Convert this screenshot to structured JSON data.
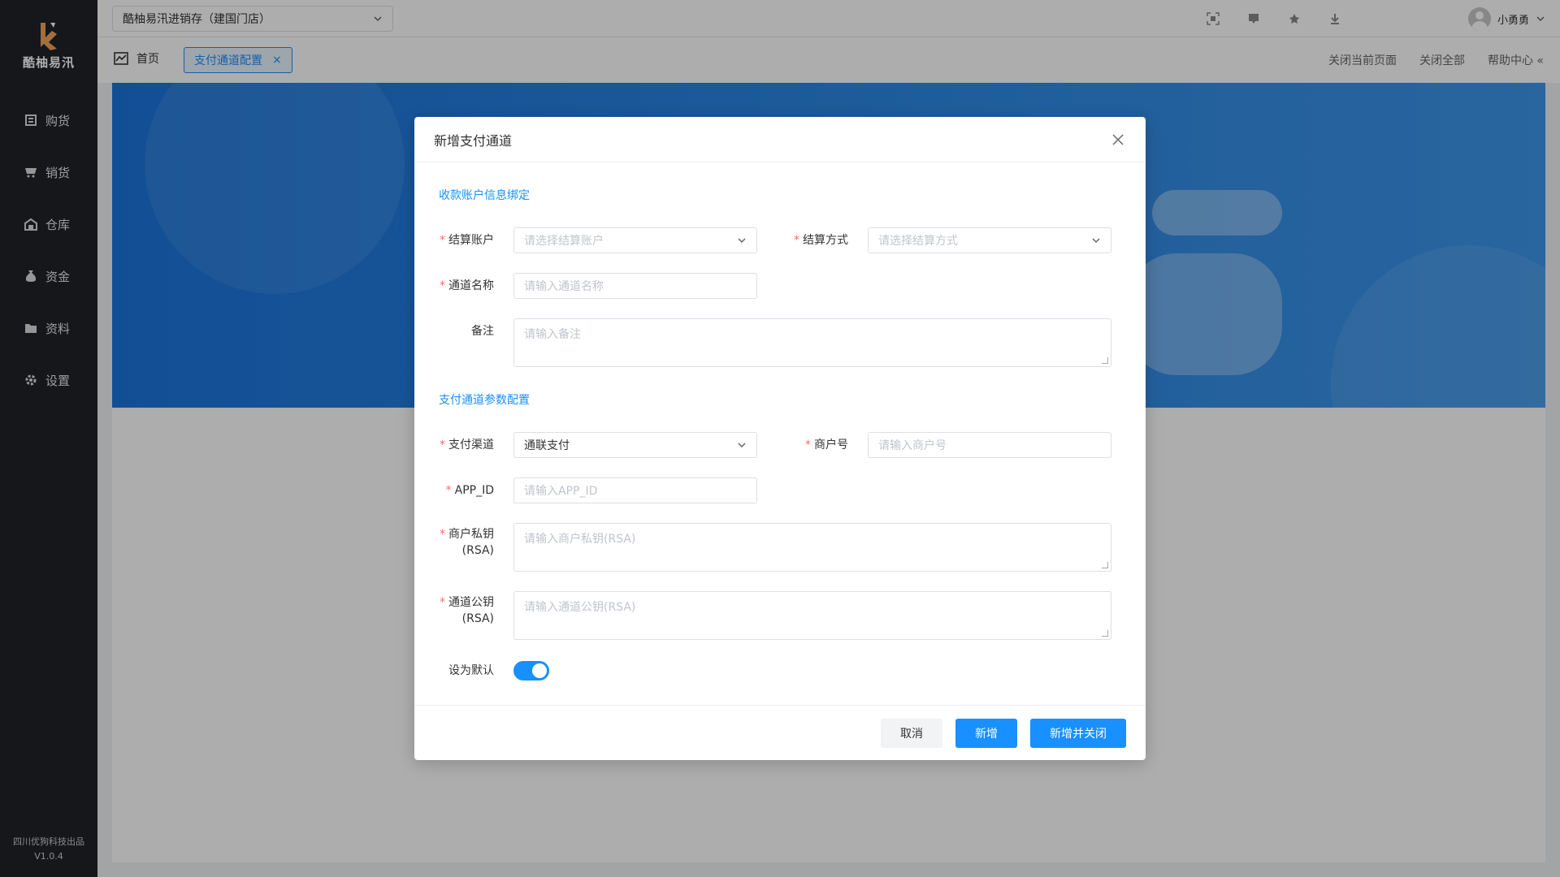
{
  "sidebar": {
    "logo_text": "酷柚易汛",
    "items": [
      {
        "label": "购货",
        "icon": "purchase-icon"
      },
      {
        "label": "销货",
        "icon": "sales-icon"
      },
      {
        "label": "仓库",
        "icon": "warehouse-icon"
      },
      {
        "label": "资金",
        "icon": "funds-icon"
      },
      {
        "label": "资料",
        "icon": "data-icon"
      },
      {
        "label": "设置",
        "icon": "gear-icon"
      }
    ],
    "footer_company": "四川优狗科技出品",
    "footer_version": "V1.0.4"
  },
  "topbar": {
    "store": "酷柚易汛进销存（建国门店）",
    "user_name": "小勇勇"
  },
  "tabbar": {
    "home_label": "首页",
    "active_tab": "支付通道配置",
    "close_current": "关闭当前页面",
    "close_all": "关闭全部",
    "help": "帮助中心"
  },
  "modal": {
    "title": "新增支付通道",
    "section1": "收款账户信息绑定",
    "settle_account_label": "结算账户",
    "settle_account_placeholder": "请选择结算账户",
    "settle_method_label": "结算方式",
    "settle_method_placeholder": "请选择结算方式",
    "channel_name_label": "通道名称",
    "channel_name_placeholder": "请输入通道名称",
    "remark_label": "备注",
    "remark_placeholder": "请输入备注",
    "section2": "支付通道参数配置",
    "pay_channel_label": "支付渠道",
    "pay_channel_value": "通联支付",
    "merchant_no_label": "商户号",
    "merchant_no_placeholder": "请输入商户号",
    "app_id_label": "APP_ID",
    "app_id_placeholder": "请输入APP_ID",
    "private_key_label_1": "商户私钥",
    "private_key_label_2": "(RSA)",
    "private_key_placeholder": "请输入商户私钥(RSA)",
    "public_key_label_1": "通道公钥",
    "public_key_label_2": "(RSA)",
    "public_key_placeholder": "请输入通道公钥(RSA)",
    "default_label": "设为默认",
    "default_on": true,
    "cancel": "取消",
    "add": "新增",
    "add_close": "新增并关闭"
  },
  "colors": {
    "primary": "#1890ff",
    "sidebar_bg": "#1f2228",
    "required": "#f56c6c"
  }
}
